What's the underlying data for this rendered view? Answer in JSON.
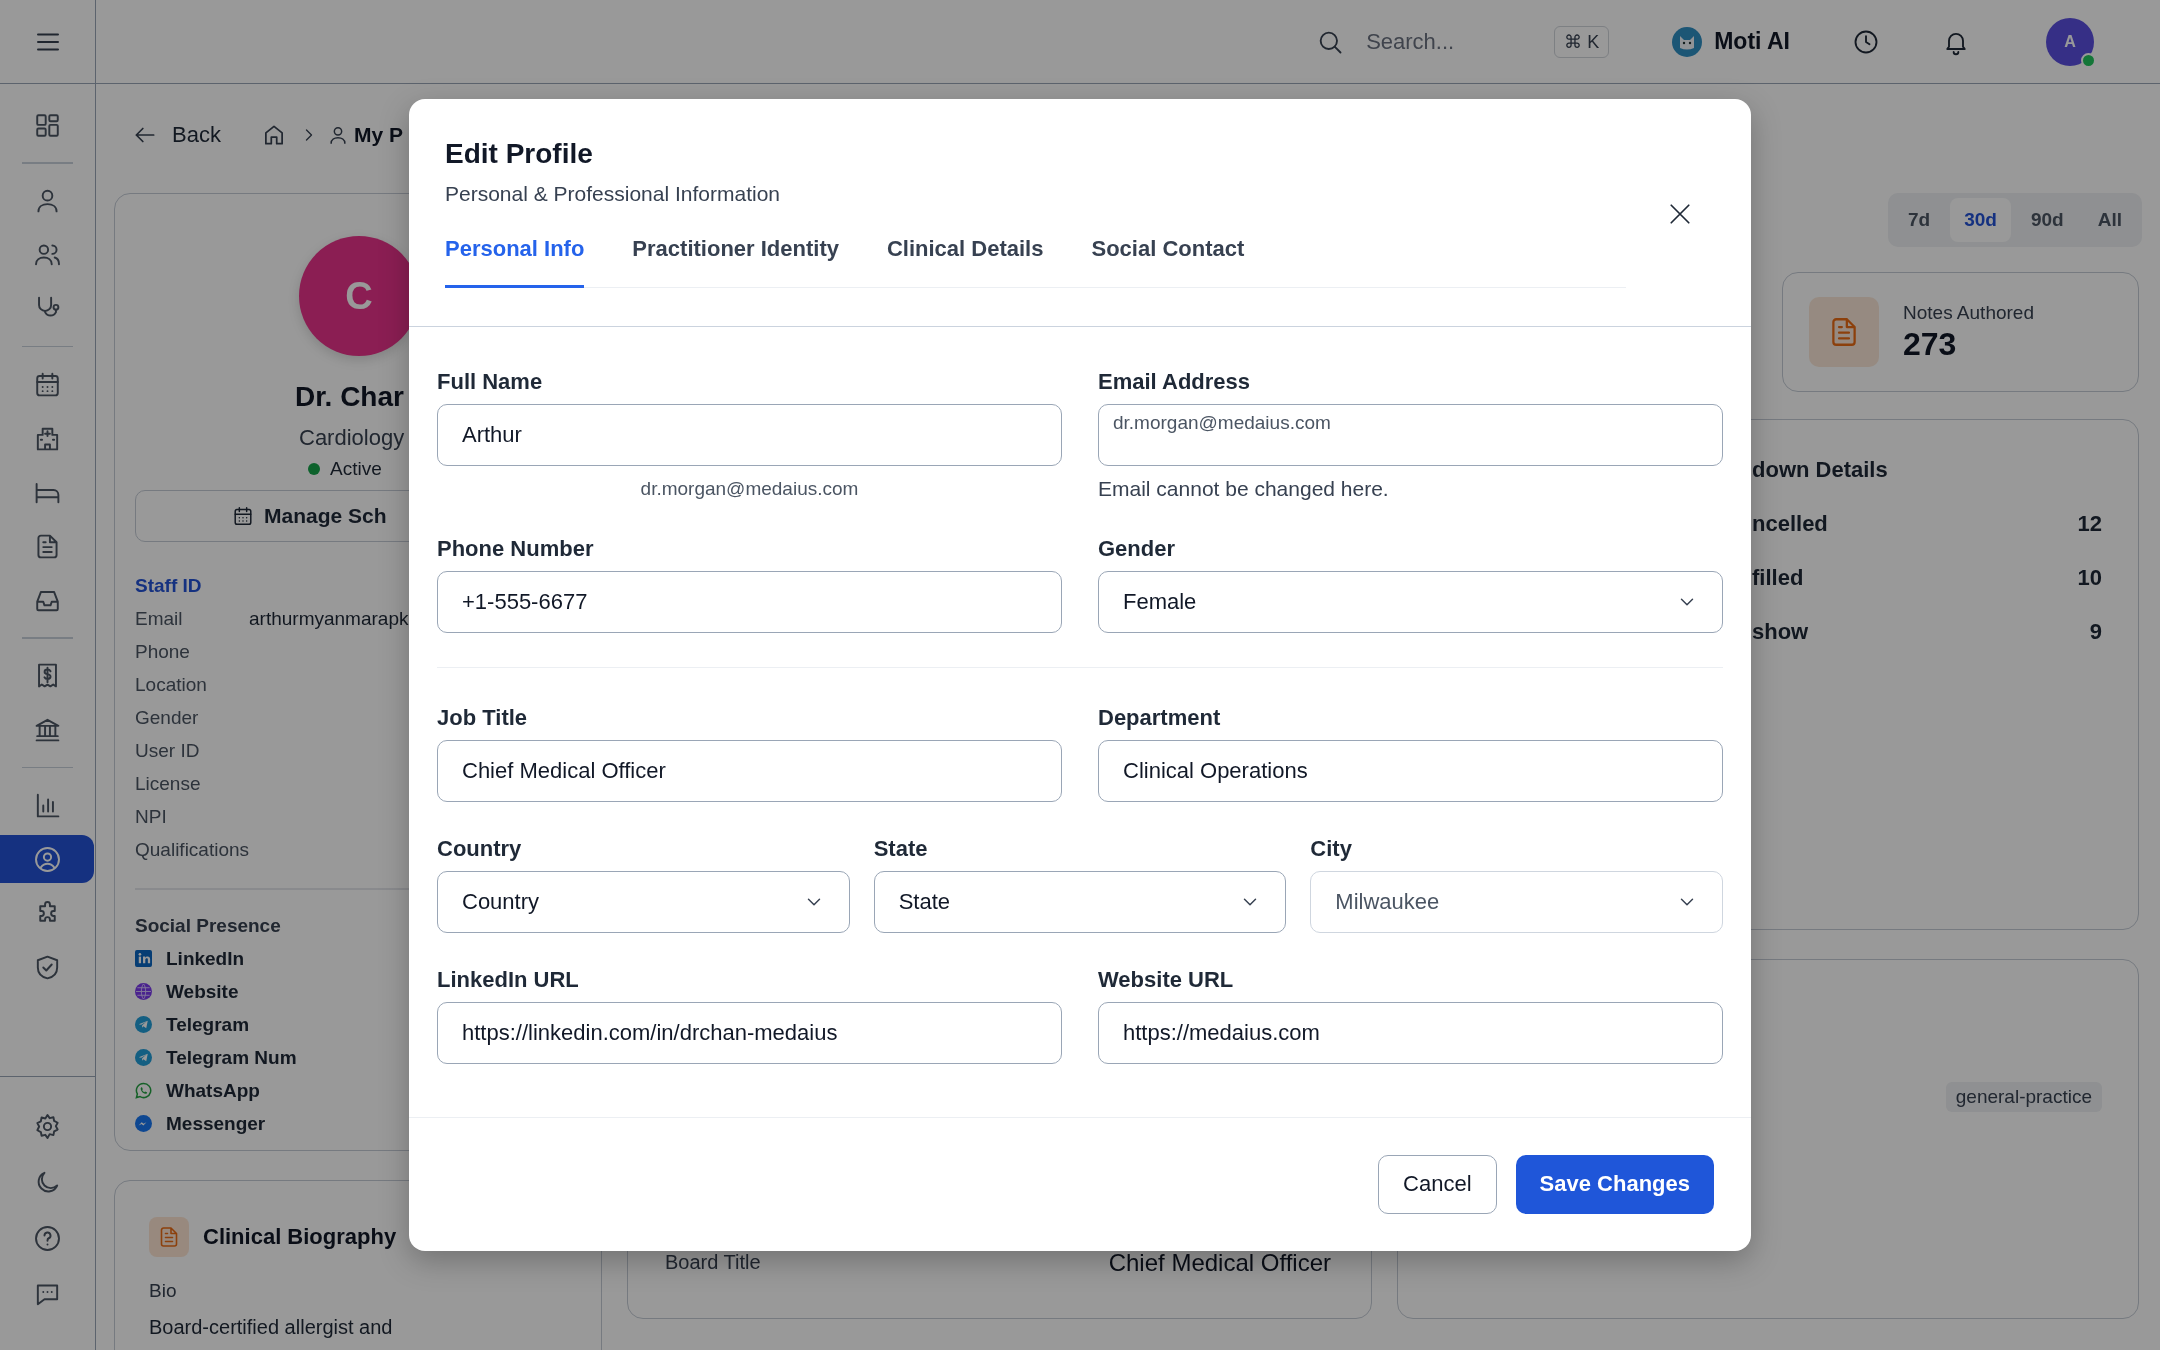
{
  "topbar": {
    "search": {
      "placeholder": "Search..."
    },
    "shortcut": "⌘ K",
    "assistant": "Moti AI",
    "user": {
      "initial": "A",
      "online": true
    }
  },
  "sidebar": {
    "groups": [
      [
        {
          "selected": false
        }
      ],
      [
        {
          "selected": false
        },
        {
          "selected": false
        },
        {
          "selected": false
        }
      ],
      [
        {
          "selected": false
        },
        {
          "selected": false
        },
        {
          "selected": false
        },
        {
          "selected": false
        },
        {
          "selected": false
        }
      ],
      [
        {
          "selected": false
        },
        {
          "selected": false
        }
      ],
      [
        {
          "selected": false
        },
        {
          "selected": true
        },
        {
          "selected": false
        },
        {
          "selected": false
        }
      ]
    ],
    "footer_items": [
      {
        "selected": false
      },
      {
        "selected": false
      },
      {
        "selected": false
      },
      {
        "selected": false
      }
    ]
  },
  "breadcrumb": {
    "back": "Back",
    "current": "My P"
  },
  "profile": {
    "initial": "C",
    "name": "Dr. Char",
    "specialty": "Cardiology",
    "status": "Active",
    "button": "Manage Sch",
    "section_title": "Staff ID",
    "fields": [
      {
        "label": "Email",
        "value": "arthurmyanmarapk"
      },
      {
        "label": "Phone"
      },
      {
        "label": "Location"
      },
      {
        "label": "Gender"
      },
      {
        "label": "User ID"
      },
      {
        "label": "License"
      },
      {
        "label": "NPI"
      },
      {
        "label": "Qualifications"
      }
    ],
    "social": {
      "title": "Social Presence",
      "items": [
        {
          "label": "LinkedIn",
          "kind": "linkedin"
        },
        {
          "label": "Website",
          "kind": "website"
        },
        {
          "label": "Telegram",
          "kind": "telegram"
        },
        {
          "label": "Telegram Num",
          "kind": "telegram"
        },
        {
          "label": "WhatsApp",
          "kind": "whatsapp"
        },
        {
          "label": "Messenger",
          "kind": "messenger"
        }
      ]
    }
  },
  "biography": {
    "title": "Clinical Biography",
    "label": "Bio",
    "text": "Board-certified allergist and"
  },
  "board_card": {
    "label": "Board Title",
    "value": "Chief Medical Officer"
  },
  "range_tabs": [
    {
      "label": "7d",
      "selected": false
    },
    {
      "label": "30d",
      "selected": true
    },
    {
      "label": "90d",
      "selected": false
    },
    {
      "label": "All",
      "selected": false
    }
  ],
  "stat": {
    "label": "Notes Authored",
    "value": "273"
  },
  "breakdown": {
    "title": "down Details",
    "rows": [
      {
        "label": "ncelled",
        "value": "12"
      },
      {
        "label": "filled",
        "value": "10"
      },
      {
        "label": "show",
        "value": "9"
      }
    ]
  },
  "tag": "general-practice",
  "modal": {
    "title": "Edit Profile",
    "subtitle": "Personal & Professional Information",
    "tabs": [
      {
        "label": "Personal Info",
        "selected": true
      },
      {
        "label": "Practitioner Identity",
        "selected": false
      },
      {
        "label": "Clinical Details",
        "selected": false
      },
      {
        "label": "Social Contact",
        "selected": false
      }
    ],
    "sections": [
      {
        "rows": [
          [
            {
              "label": "Full Name",
              "kind": "text",
              "value": "Arthur",
              "hint": "dr.morgan@medaius.com"
            },
            {
              "label": "Email Address",
              "kind": "readonly",
              "value": "dr.morgan@medaius.com",
              "hint": "Email cannot be changed here."
            }
          ],
          [
            {
              "label": "Phone Number",
              "kind": "text",
              "value": "+1-555-6677"
            },
            {
              "label": "Gender",
              "kind": "select",
              "value": "Female",
              "disabled": false
            }
          ]
        ]
      },
      {
        "rows": [
          [
            {
              "label": "Job Title",
              "kind": "text",
              "value": "Chief Medical Officer"
            },
            {
              "label": "Department",
              "kind": "text",
              "value": "Clinical Operations"
            }
          ],
          [
            {
              "label": "Country",
              "kind": "select",
              "value": "Country",
              "disabled": false
            },
            {
              "label": "State",
              "kind": "select",
              "value": "State",
              "disabled": false
            },
            {
              "label": "City",
              "kind": "select",
              "value": "Milwaukee",
              "disabled": true
            }
          ],
          [
            {
              "label": "LinkedIn URL",
              "kind": "text",
              "value": "https://linkedin.com/in/drchan-medaius"
            },
            {
              "label": "Website URL",
              "kind": "text",
              "value": "https://medaius.com"
            }
          ]
        ]
      }
    ],
    "buttons": [
      {
        "label": "Cancel",
        "kind": "secondary"
      },
      {
        "label": "Save Changes",
        "kind": "primary"
      }
    ]
  }
}
